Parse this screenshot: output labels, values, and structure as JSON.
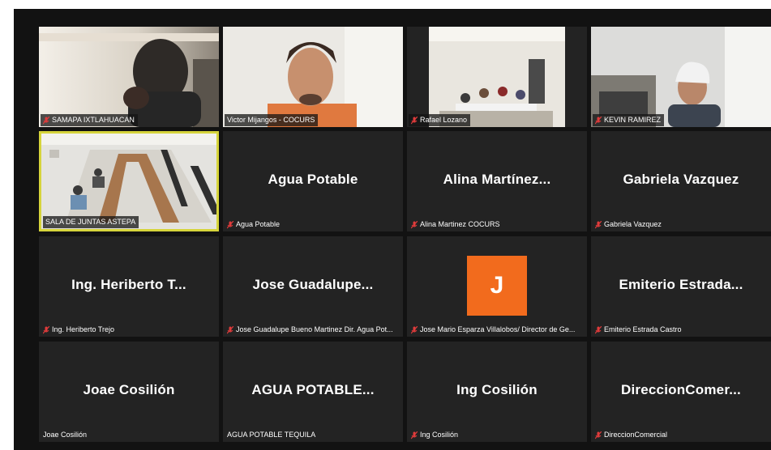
{
  "participants": [
    {
      "display_name": "SAMAPA IXTLAHUACAN",
      "label": "SAMAPA IXTLAHUACAN",
      "muted": true,
      "video": true
    },
    {
      "display_name": "Victor Mijangos - COCURS",
      "label": "Victor Mijangos - COCURS",
      "muted": false,
      "video": true
    },
    {
      "display_name": "Rafael Lozano",
      "label": "Rafael Lozano",
      "muted": true,
      "video": true
    },
    {
      "display_name": "KEVIN RAMIREZ",
      "label": "KEVIN RAMIREZ",
      "muted": true,
      "video": true
    },
    {
      "display_name": "SALA DE JUNTAS ASTEPA",
      "label": "SALA DE JUNTAS ASTEPA",
      "muted": false,
      "video": true,
      "active_speaker": true
    },
    {
      "display_name": "Agua Potable",
      "label": "Agua Potable",
      "muted": true,
      "video": false
    },
    {
      "display_name": "Alina Martínez...",
      "label": "Alina Martinez COCURS",
      "muted": true,
      "video": false
    },
    {
      "display_name": "Gabriela Vazquez",
      "label": "Gabriela Vazquez",
      "muted": true,
      "video": false
    },
    {
      "display_name": "Ing. Heriberto T...",
      "label": "Ing. Heriberto Trejo",
      "muted": true,
      "video": false
    },
    {
      "display_name": "Jose Guadalupe...",
      "label": "Jose Guadalupe Bueno Martinez Dir. Agua Pot...",
      "muted": true,
      "video": false
    },
    {
      "display_name": "J",
      "label": "Jose Mario Esparza Villalobos/ Director de Ge...",
      "muted": true,
      "video": false,
      "avatar": true
    },
    {
      "display_name": "Emiterio Estrada...",
      "label": "Emiterio Estrada Castro",
      "muted": true,
      "video": false
    },
    {
      "display_name": "Joae Cosilión",
      "label": "Joae Cosilión",
      "muted": false,
      "video": false
    },
    {
      "display_name": "AGUA POTABLE...",
      "label": "AGUA POTABLE TEQUILA",
      "muted": false,
      "video": false
    },
    {
      "display_name": "Ing Cosilión",
      "label": "Ing Cosilión",
      "muted": true,
      "video": false
    },
    {
      "display_name": "DireccionComer...",
      "label": "DireccionComercial",
      "muted": true,
      "video": false
    }
  ],
  "colors": {
    "background": "#121212",
    "tile": "#232323",
    "active_border": "#d6d43b",
    "mute_icon": "#e03b3b",
    "avatar": "#f26b1d"
  },
  "icons": {
    "muted": "microphone-muted-icon"
  }
}
